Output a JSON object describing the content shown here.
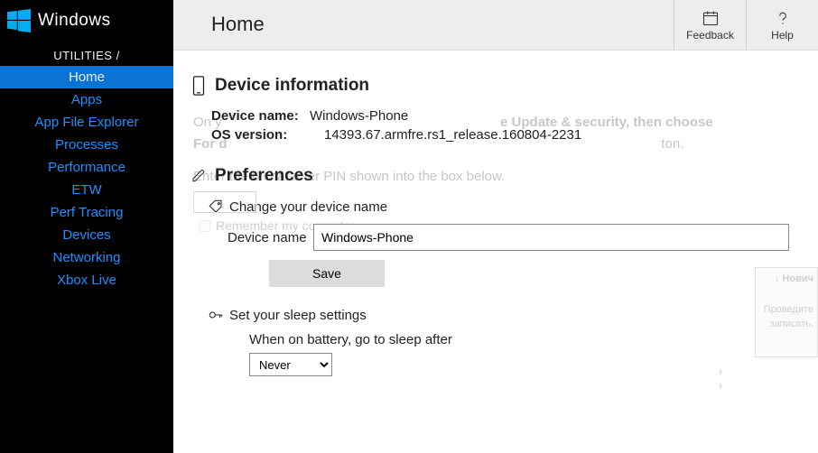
{
  "sidebar": {
    "brand": "Windows",
    "breadcrumb": "UTILITIES /",
    "items": [
      {
        "label": "Home",
        "active": true
      },
      {
        "label": "Apps"
      },
      {
        "label": "App File Explorer"
      },
      {
        "label": "Processes"
      },
      {
        "label": "Performance"
      },
      {
        "label": "ETW"
      },
      {
        "label": "Perf Tracing"
      },
      {
        "label": "Devices"
      },
      {
        "label": "Networking"
      },
      {
        "label": "Xbox Live"
      }
    ]
  },
  "topbar": {
    "title": "Home",
    "feedback": "Feedback",
    "help": "Help"
  },
  "sections": {
    "device_info": {
      "heading": "Device information",
      "device_name_label": "Device name:",
      "device_name_value": "Windows-Phone",
      "os_version_label": "OS version:",
      "os_version_value": "14393.67.armfre.rs1_release.160804-2231"
    },
    "preferences": {
      "heading": "Preferences",
      "change_name_label": "Change your device name",
      "device_name_field_label": "Device name",
      "device_name_field_value": "Windows-Phone",
      "save_button": "Save",
      "sleep_heading": "Set your sleep settings",
      "battery_label": "When on battery, go to sleep after",
      "battery_value": "Never"
    }
  },
  "ghost": {
    "l1a": "On y",
    "l1b": "e Update & security, then choose",
    "l2": "For d",
    "l3": "ton.",
    "pin": "Enter the 6 character PIN shown into the box below.",
    "remember": "Remember my computer",
    "side_top": "↓  Нович",
    "side_1": "Проведите",
    "side_2": "записать."
  }
}
